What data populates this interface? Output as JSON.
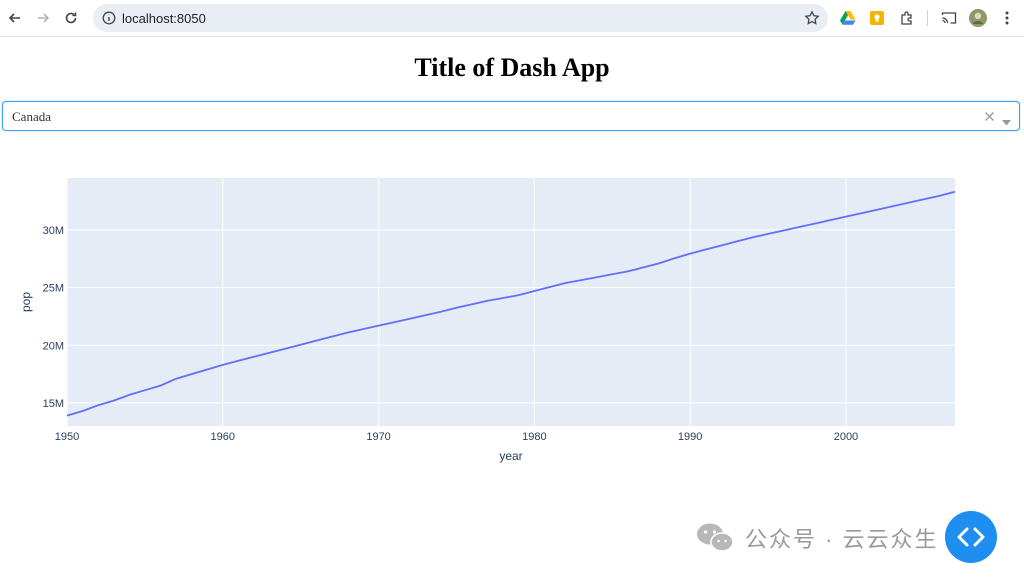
{
  "browser": {
    "url": "localhost:8050"
  },
  "page": {
    "title": "Title of Dash App",
    "dropdown_value": "Canada"
  },
  "watermark": {
    "text": "公众号 · 云云众生"
  },
  "colors": {
    "line": "#636efa",
    "plot_bg": "#e5ecf6",
    "dropdown_border": "#3aa0f3",
    "fab": "#1e8ef0"
  },
  "chart_data": {
    "type": "line",
    "xlabel": "year",
    "ylabel": "pop",
    "xlim": [
      1950,
      2007
    ],
    "ylim": [
      13000000,
      34500000
    ],
    "x_ticks": [
      1950,
      1960,
      1970,
      1980,
      1990,
      2000
    ],
    "x_tick_labels": [
      "1950",
      "1960",
      "1970",
      "1980",
      "1990",
      "2000"
    ],
    "y_ticks": [
      15000000,
      20000000,
      25000000,
      30000000
    ],
    "y_tick_labels": [
      "15M",
      "20M",
      "25M",
      "30M"
    ],
    "grid": true,
    "series": [
      {
        "x": [
          1950,
          1951,
          1952,
          1953,
          1954,
          1955,
          1956,
          1957,
          1958,
          1959,
          1960,
          1961,
          1962,
          1963,
          1964,
          1965,
          1966,
          1967,
          1968,
          1969,
          1970,
          1971,
          1972,
          1973,
          1974,
          1975,
          1976,
          1977,
          1978,
          1979,
          1980,
          1981,
          1982,
          1983,
          1984,
          1985,
          1986,
          1987,
          1988,
          1989,
          1990,
          1991,
          1992,
          1993,
          1994,
          1995,
          1996,
          1997,
          1998,
          1999,
          2000,
          2001,
          2002,
          2003,
          2004,
          2005,
          2006,
          2007
        ],
        "y": [
          13900000,
          14300000,
          14800000,
          15200000,
          15700000,
          16100000,
          16500000,
          17100000,
          17500000,
          17900000,
          18300000,
          18650000,
          19000000,
          19350000,
          19700000,
          20050000,
          20400000,
          20750000,
          21100000,
          21400000,
          21700000,
          22000000,
          22300000,
          22600000,
          22900000,
          23250000,
          23550000,
          23850000,
          24100000,
          24350000,
          24700000,
          25050000,
          25400000,
          25650000,
          25900000,
          26150000,
          26400000,
          26750000,
          27100000,
          27550000,
          27950000,
          28300000,
          28650000,
          29000000,
          29350000,
          29650000,
          29950000,
          30250000,
          30550000,
          30850000,
          31150000,
          31450000,
          31750000,
          32050000,
          32350000,
          32650000,
          32950000,
          33300000
        ]
      }
    ]
  }
}
